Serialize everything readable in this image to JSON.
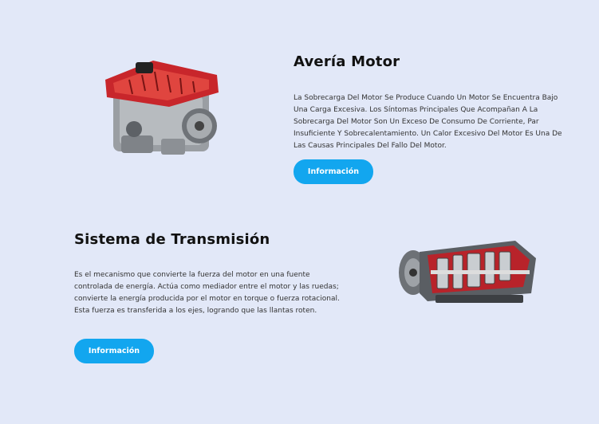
{
  "sections": [
    {
      "title": "Avería Motor",
      "description": "La Sobrecarga Del Motor Se Produce Cuando Un Motor Se Encuentra Bajo Una Carga Excesiva. Los Síntomas Principales Que Acompañan A La Sobrecarga Del Motor Son Un Exceso De Consumo De Corriente, Par Insuficiente Y Sobrecalentamiento. Un Calor Excesivo Del Motor Es Una De Las Causas Principales Del Fallo Del Motor.",
      "button_label": "Información"
    },
    {
      "title": "Sistema de Transmisión",
      "description": "Es el mecanismo que convierte la fuerza del motor en una fuente controlada de energía. Actúa como mediador entre el motor y las ruedas; convierte la energía producida por el motor en torque o fuerza rotacional. Esta fuerza es transferida a los ejes, logrando que las llantas roten.",
      "button_label": "Información"
    }
  ],
  "colors": {
    "background": "#e2e8f8",
    "button": "#12a6ef",
    "engine_accent": "#c8262b"
  },
  "icons": [
    "engine-image",
    "transmission-image"
  ]
}
